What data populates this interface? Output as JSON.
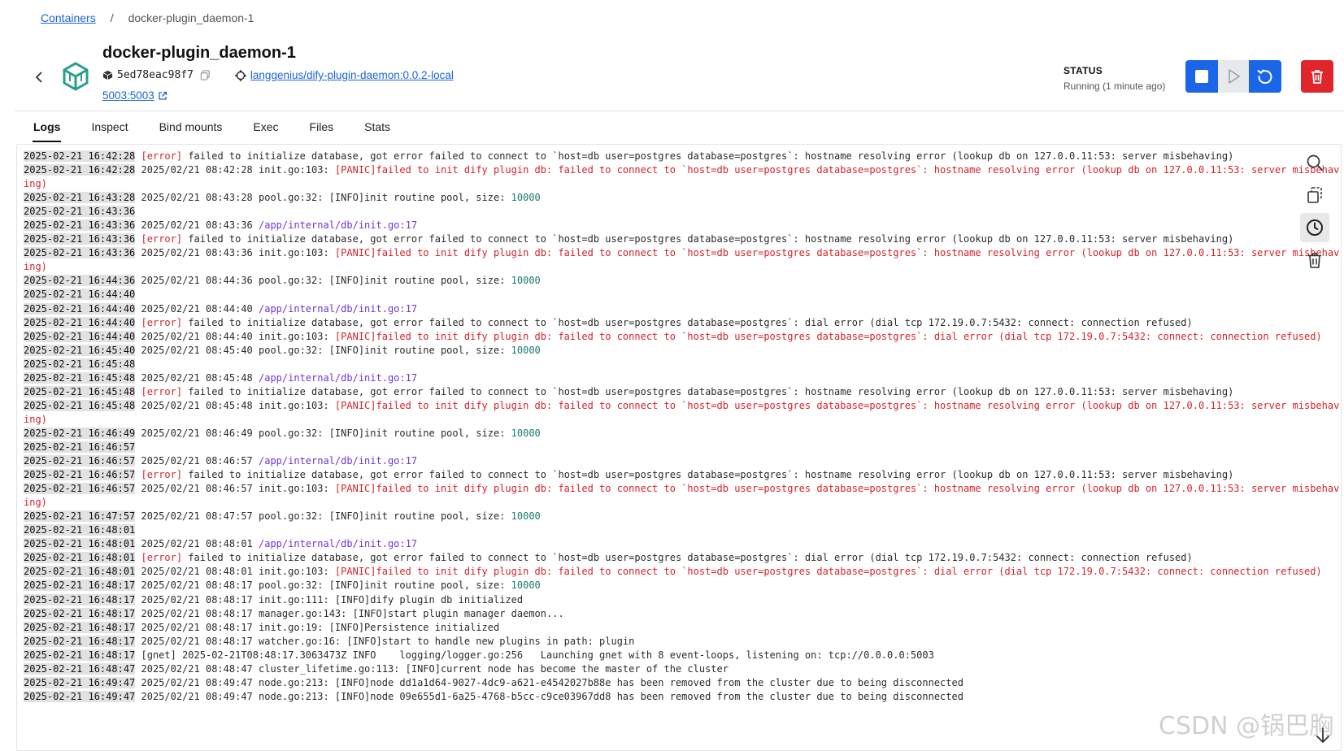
{
  "breadcrumb": {
    "parent": "Containers",
    "separator": "/",
    "current": "docker-plugin_daemon-1"
  },
  "container": {
    "name": "docker-plugin_daemon-1",
    "id": "5ed78eac98f7",
    "image": "langgenius/dify-plugin-daemon:0.0.2-local",
    "port": "5003:5003"
  },
  "status": {
    "label": "STATUS",
    "value": "Running (1 minute ago)"
  },
  "actions": {
    "stop_icon": "stop-icon",
    "start_icon": "play-icon",
    "restart_icon": "restart-icon",
    "delete_icon": "trash-icon",
    "accent": "#1a65e8",
    "danger": "#e0252c"
  },
  "tabs": [
    "Logs",
    "Inspect",
    "Bind mounts",
    "Exec",
    "Files",
    "Stats"
  ],
  "active_tab": "Logs",
  "log_toolbar": [
    "search-icon",
    "copy-icon",
    "clock-icon",
    "trash-icon"
  ],
  "logs": [
    [
      {
        "t": "ts",
        "v": "2025-02-21 16:42:28"
      },
      {
        "t": "",
        "v": " "
      },
      {
        "t": "err",
        "v": "[error]"
      },
      {
        "t": "",
        "v": " failed to initialize database, got error failed to connect to `host=db user=postgres database=postgres`: hostname resolving error (lookup db on 127.0.0.11:53: server misbehaving)"
      }
    ],
    [
      {
        "t": "ts",
        "v": "2025-02-21 16:42:28"
      },
      {
        "t": "",
        "v": " 2025/02/21 08:42:28 init.go:103: "
      },
      {
        "t": "err",
        "v": "[PANIC]failed to init dify plugin db: failed to connect to `host=db user=postgres database=postgres`: hostname resolving error (lookup db on 127.0.0.11:53: server misbehav"
      }
    ],
    [
      {
        "t": "err",
        "v": "ing)"
      }
    ],
    [
      {
        "t": "ts",
        "v": "2025-02-21 16:43:28"
      },
      {
        "t": "",
        "v": " 2025/02/21 08:43:28 pool.go:32: [INFO]init routine pool, size: "
      },
      {
        "t": "ok",
        "v": "10000"
      }
    ],
    [
      {
        "t": "ts",
        "v": "2025-02-21 16:43:36"
      }
    ],
    [
      {
        "t": "ts",
        "v": "2025-02-21 16:43:36"
      },
      {
        "t": "",
        "v": " 2025/02/21 08:43:36 "
      },
      {
        "t": "path",
        "v": "/app/internal/db/init.go:17"
      }
    ],
    [
      {
        "t": "ts",
        "v": "2025-02-21 16:43:36"
      },
      {
        "t": "",
        "v": " "
      },
      {
        "t": "err",
        "v": "[error]"
      },
      {
        "t": "",
        "v": " failed to initialize database, got error failed to connect to `host=db user=postgres database=postgres`: hostname resolving error (lookup db on 127.0.0.11:53: server misbehaving)"
      }
    ],
    [
      {
        "t": "ts",
        "v": "2025-02-21 16:43:36"
      },
      {
        "t": "",
        "v": " 2025/02/21 08:43:36 init.go:103: "
      },
      {
        "t": "err",
        "v": "[PANIC]failed to init dify plugin db: failed to connect to `host=db user=postgres database=postgres`: hostname resolving error (lookup db on 127.0.0.11:53: server misbehav"
      }
    ],
    [
      {
        "t": "err",
        "v": "ing)"
      }
    ],
    [
      {
        "t": "ts",
        "v": "2025-02-21 16:44:36"
      },
      {
        "t": "",
        "v": " 2025/02/21 08:44:36 pool.go:32: [INFO]init routine pool, size: "
      },
      {
        "t": "ok",
        "v": "10000"
      }
    ],
    [
      {
        "t": "ts",
        "v": "2025-02-21 16:44:40"
      }
    ],
    [
      {
        "t": "ts",
        "v": "2025-02-21 16:44:40"
      },
      {
        "t": "",
        "v": " 2025/02/21 08:44:40 "
      },
      {
        "t": "path",
        "v": "/app/internal/db/init.go:17"
      }
    ],
    [
      {
        "t": "ts",
        "v": "2025-02-21 16:44:40"
      },
      {
        "t": "",
        "v": " "
      },
      {
        "t": "err",
        "v": "[error]"
      },
      {
        "t": "",
        "v": " failed to initialize database, got error failed to connect to `host=db user=postgres database=postgres`: dial error (dial tcp 172.19.0.7:5432: connect: connection refused)"
      }
    ],
    [
      {
        "t": "ts",
        "v": "2025-02-21 16:44:40"
      },
      {
        "t": "",
        "v": " 2025/02/21 08:44:40 init.go:103: "
      },
      {
        "t": "err",
        "v": "[PANIC]failed to init dify plugin db: failed to connect to `host=db user=postgres database=postgres`: dial error (dial tcp 172.19.0.7:5432: connect: connection refused)"
      }
    ],
    [
      {
        "t": "ts",
        "v": "2025-02-21 16:45:40"
      },
      {
        "t": "",
        "v": " 2025/02/21 08:45:40 pool.go:32: [INFO]init routine pool, size: "
      },
      {
        "t": "ok",
        "v": "10000"
      }
    ],
    [
      {
        "t": "ts",
        "v": "2025-02-21 16:45:48"
      }
    ],
    [
      {
        "t": "ts",
        "v": "2025-02-21 16:45:48"
      },
      {
        "t": "",
        "v": " 2025/02/21 08:45:48 "
      },
      {
        "t": "path",
        "v": "/app/internal/db/init.go:17"
      }
    ],
    [
      {
        "t": "ts",
        "v": "2025-02-21 16:45:48"
      },
      {
        "t": "",
        "v": " "
      },
      {
        "t": "err",
        "v": "[error]"
      },
      {
        "t": "",
        "v": " failed to initialize database, got error failed to connect to `host=db user=postgres database=postgres`: hostname resolving error (lookup db on 127.0.0.11:53: server misbehaving)"
      }
    ],
    [
      {
        "t": "ts",
        "v": "2025-02-21 16:45:48"
      },
      {
        "t": "",
        "v": " 2025/02/21 08:45:48 init.go:103: "
      },
      {
        "t": "err",
        "v": "[PANIC]failed to init dify plugin db: failed to connect to `host=db user=postgres database=postgres`: hostname resolving error (lookup db on 127.0.0.11:53: server misbehav"
      }
    ],
    [
      {
        "t": "err",
        "v": "ing)"
      }
    ],
    [
      {
        "t": "ts",
        "v": "2025-02-21 16:46:49"
      },
      {
        "t": "",
        "v": " 2025/02/21 08:46:49 pool.go:32: [INFO]init routine pool, size: "
      },
      {
        "t": "ok",
        "v": "10000"
      }
    ],
    [
      {
        "t": "ts",
        "v": "2025-02-21 16:46:57"
      }
    ],
    [
      {
        "t": "ts",
        "v": "2025-02-21 16:46:57"
      },
      {
        "t": "",
        "v": " 2025/02/21 08:46:57 "
      },
      {
        "t": "path",
        "v": "/app/internal/db/init.go:17"
      }
    ],
    [
      {
        "t": "ts",
        "v": "2025-02-21 16:46:57"
      },
      {
        "t": "",
        "v": " "
      },
      {
        "t": "err",
        "v": "[error]"
      },
      {
        "t": "",
        "v": " failed to initialize database, got error failed to connect to `host=db user=postgres database=postgres`: hostname resolving error (lookup db on 127.0.0.11:53: server misbehaving)"
      }
    ],
    [
      {
        "t": "ts",
        "v": "2025-02-21 16:46:57"
      },
      {
        "t": "",
        "v": " 2025/02/21 08:46:57 init.go:103: "
      },
      {
        "t": "err",
        "v": "[PANIC]failed to init dify plugin db: failed to connect to `host=db user=postgres database=postgres`: hostname resolving error (lookup db on 127.0.0.11:53: server misbehav"
      }
    ],
    [
      {
        "t": "err",
        "v": "ing)"
      }
    ],
    [
      {
        "t": "ts",
        "v": "2025-02-21 16:47:57"
      },
      {
        "t": "",
        "v": " 2025/02/21 08:47:57 pool.go:32: [INFO]init routine pool, size: "
      },
      {
        "t": "ok",
        "v": "10000"
      }
    ],
    [
      {
        "t": "ts",
        "v": "2025-02-21 16:48:01"
      }
    ],
    [
      {
        "t": "ts",
        "v": "2025-02-21 16:48:01"
      },
      {
        "t": "",
        "v": " 2025/02/21 08:48:01 "
      },
      {
        "t": "path",
        "v": "/app/internal/db/init.go:17"
      }
    ],
    [
      {
        "t": "ts",
        "v": "2025-02-21 16:48:01"
      },
      {
        "t": "",
        "v": " "
      },
      {
        "t": "err",
        "v": "[error]"
      },
      {
        "t": "",
        "v": " failed to initialize database, got error failed to connect to `host=db user=postgres database=postgres`: dial error (dial tcp 172.19.0.7:5432: connect: connection refused)"
      }
    ],
    [
      {
        "t": "ts",
        "v": "2025-02-21 16:48:01"
      },
      {
        "t": "",
        "v": " 2025/02/21 08:48:01 init.go:103: "
      },
      {
        "t": "err",
        "v": "[PANIC]failed to init dify plugin db: failed to connect to `host=db user=postgres database=postgres`: dial error (dial tcp 172.19.0.7:5432: connect: connection refused)"
      }
    ],
    [
      {
        "t": "ts",
        "v": "2025-02-21 16:48:17"
      },
      {
        "t": "",
        "v": " 2025/02/21 08:48:17 pool.go:32: [INFO]init routine pool, size: "
      },
      {
        "t": "ok",
        "v": "10000"
      }
    ],
    [
      {
        "t": "ts",
        "v": "2025-02-21 16:48:17"
      },
      {
        "t": "",
        "v": " 2025/02/21 08:48:17 init.go:111: [INFO]dify plugin db initialized"
      }
    ],
    [
      {
        "t": "ts",
        "v": "2025-02-21 16:48:17"
      },
      {
        "t": "",
        "v": " 2025/02/21 08:48:17 manager.go:143: [INFO]start plugin manager daemon..."
      }
    ],
    [
      {
        "t": "ts",
        "v": "2025-02-21 16:48:17"
      },
      {
        "t": "",
        "v": " 2025/02/21 08:48:17 init.go:19: [INFO]Persistence initialized"
      }
    ],
    [
      {
        "t": "ts",
        "v": "2025-02-21 16:48:17"
      },
      {
        "t": "",
        "v": " 2025/02/21 08:48:17 watcher.go:16: [INFO]start to handle new plugins in path: plugin"
      }
    ],
    [
      {
        "t": "ts",
        "v": "2025-02-21 16:48:17"
      },
      {
        "t": "",
        "v": " [gnet] 2025-02-21T08:48:17.3063473Z INFO    logging/logger.go:256   Launching gnet with 8 event-loops, listening on: tcp://0.0.0.0:5003"
      }
    ],
    [
      {
        "t": "ts",
        "v": "2025-02-21 16:48:47"
      },
      {
        "t": "",
        "v": " 2025/02/21 08:48:47 cluster_lifetime.go:113: [INFO]current node has become the master of the cluster"
      }
    ],
    [
      {
        "t": "ts",
        "v": "2025-02-21 16:49:47"
      },
      {
        "t": "",
        "v": " 2025/02/21 08:49:47 node.go:213: [INFO]node dd1a1d64-9027-4dc9-a621-e4542027b88e has been removed from the cluster due to being disconnected"
      }
    ],
    [
      {
        "t": "ts",
        "v": "2025-02-21 16:49:47"
      },
      {
        "t": "",
        "v": " 2025/02/21 08:49:47 node.go:213: [INFO]node 09e655d1-6a25-4768-b5cc-c9ce03967dd8 has been removed from the cluster due to being disconnected"
      }
    ]
  ],
  "watermark": "CSDN @锅巴胸"
}
